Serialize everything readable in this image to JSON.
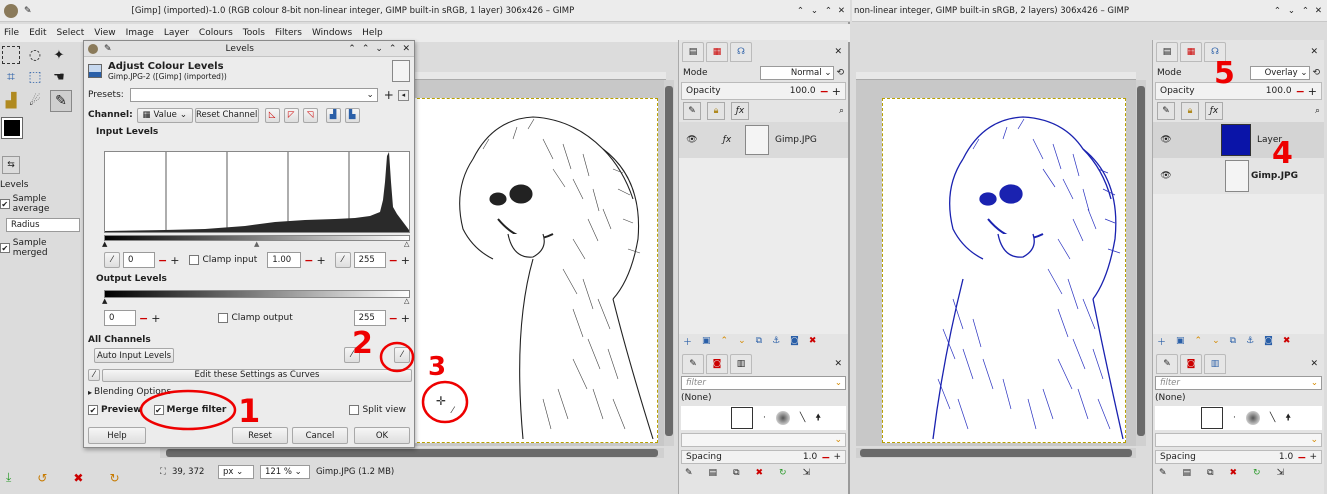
{
  "left_window": {
    "title": "[Gimp] (imported)-1.0 (RGB colour 8-bit non-linear integer, GIMP built-in sRGB, 1 layer) 306x426 – GIMP",
    "menu": [
      "File",
      "Edit",
      "Select",
      "View",
      "Image",
      "Layer",
      "Colours",
      "Tools",
      "Filters",
      "Windows",
      "Help"
    ],
    "tool_options": {
      "label": "Levels",
      "sample_average": "Sample average",
      "radius": "Radius",
      "sample_merged": "Sample merged"
    },
    "status": {
      "coords": "39, 372",
      "unit": "px",
      "zoom": "121 %",
      "file": "Gimp.JPG (1.2 MB)"
    },
    "layers_panel": {
      "mode_label": "Mode",
      "mode_value": "Normal",
      "opacity_label": "Opacity",
      "opacity_value": "100.0",
      "layer_name": "Gimp.JPG",
      "filter_placeholder": "filter",
      "brush_none": "(None)",
      "spacing_label": "Spacing",
      "spacing_value": "1.0"
    }
  },
  "levels_dialog": {
    "title": "Levels",
    "heading": "Adjust Colour Levels",
    "subheading": "Gimp.JPG-2 ([Gimp] (imported))",
    "presets_label": "Presets:",
    "channel_label": "Channel:",
    "channel_value": "Value",
    "reset_channel": "Reset Channel",
    "input_levels": "Input Levels",
    "input_low": "0",
    "clamp_input": "Clamp input",
    "gamma": "1.00",
    "input_high": "255",
    "output_levels": "Output Levels",
    "output_low": "0",
    "clamp_output": "Clamp output",
    "output_high": "255",
    "all_channels": "All Channels",
    "auto_input": "Auto Input Levels",
    "edit_curves": "Edit these Settings as Curves",
    "blending": "Blending Options",
    "preview": "Preview",
    "merge_filter": "Merge filter",
    "split_view": "Split view",
    "help": "Help",
    "reset": "Reset",
    "cancel": "Cancel",
    "ok": "OK"
  },
  "right_window": {
    "title": "non-linear integer, GIMP built-in sRGB, 2 layers) 306x426 – GIMP",
    "layers_panel": {
      "mode_label": "Mode",
      "mode_value": "Overlay",
      "opacity_label": "Opacity",
      "opacity_value": "100.0",
      "layer1_name": "Layer",
      "layer2_name": "Gimp.JPG",
      "filter_placeholder": "filter",
      "brush_none": "(None)",
      "spacing_label": "Spacing",
      "spacing_value": "1.0"
    },
    "layer_fill_color": "#0a14a8"
  },
  "annotations": {
    "n1": "1",
    "n2": "2",
    "n3": "3",
    "n4": "4",
    "n5": "5"
  },
  "colors": {
    "annotation": "#e00000",
    "dialog_bg": "#ececec",
    "canvas_bg": "#c8c8c8"
  }
}
